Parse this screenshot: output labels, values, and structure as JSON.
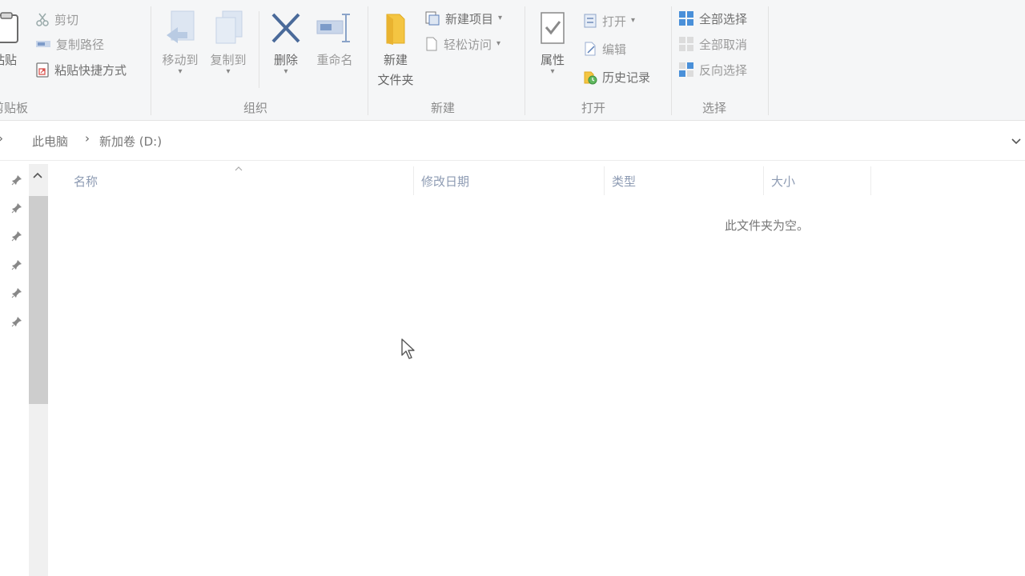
{
  "ribbon": {
    "clipboard": {
      "paste_label": "粘贴",
      "cut_label": "剪切",
      "copy_path_label": "复制路径",
      "paste_shortcut_label": "粘贴快捷方式",
      "group_label": "剪贴板"
    },
    "organize": {
      "move_to_label": "移动到",
      "copy_to_label": "复制到",
      "delete_label": "删除",
      "rename_label": "重命名",
      "group_label": "组织"
    },
    "new": {
      "new_folder_line1": "新建",
      "new_folder_line2": "文件夹",
      "new_item_label": "新建项目",
      "easy_access_label": "轻松访问",
      "group_label": "新建"
    },
    "open": {
      "properties_label": "属性",
      "open_label": "打开",
      "edit_label": "编辑",
      "history_label": "历史记录",
      "group_label": "打开"
    },
    "select": {
      "select_all_label": "全部选择",
      "select_none_label": "全部取消",
      "invert_label": "反向选择",
      "group_label": "选择"
    }
  },
  "address": {
    "crumbs": [
      "此电脑",
      "新加卷 (D:)"
    ]
  },
  "columns": {
    "name": "名称",
    "modified": "修改日期",
    "type": "类型",
    "size": "大小"
  },
  "content": {
    "empty_message": "此文件夹为空。"
  },
  "colors": {
    "accent_blue": "#4a78c2",
    "folder_yellow": "#f4c542",
    "ribbon_bg": "#f5f6f7"
  }
}
